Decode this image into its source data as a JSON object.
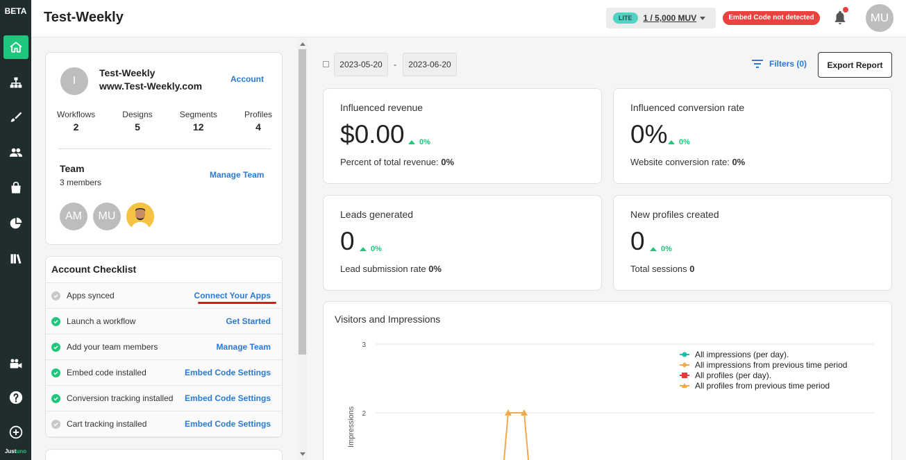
{
  "sidebar": {
    "badge": "BETA",
    "brand_main": "Just",
    "brand_accent": "uno",
    "items": [
      {
        "name": "home-icon"
      },
      {
        "name": "workflows-icon"
      },
      {
        "name": "designs-brush-icon"
      },
      {
        "name": "segments-users-icon"
      },
      {
        "name": "shopping-bag-icon"
      },
      {
        "name": "reports-pie-icon"
      },
      {
        "name": "library-books-icon"
      }
    ],
    "bottom_items": [
      {
        "name": "video-camera-icon"
      },
      {
        "name": "help-icon"
      },
      {
        "name": "add-circle-icon"
      }
    ]
  },
  "header": {
    "title": "Test-Weekly",
    "plan": "LITE",
    "muv": "1 / 5,000 MUV",
    "embed_status": "Embed Code not detected",
    "avatar": "MU"
  },
  "account": {
    "avatar": "I",
    "name": "Test-Weekly",
    "site": "www.Test-Weekly.com",
    "link": "Account",
    "stats": [
      {
        "label": "Workflows",
        "value": "2"
      },
      {
        "label": "Designs",
        "value": "5"
      },
      {
        "label": "Segments",
        "value": "12"
      },
      {
        "label": "Profiles",
        "value": "4"
      }
    ],
    "team_title": "Team",
    "team_count": "3 members",
    "team_link": "Manage Team",
    "members": [
      "AM",
      "MU"
    ]
  },
  "checklist": {
    "title": "Account Checklist",
    "items": [
      {
        "label": "Apps synced",
        "action": "Connect Your Apps",
        "done": false
      },
      {
        "label": "Launch a workflow",
        "action": "Get Started",
        "done": true
      },
      {
        "label": "Add your team members",
        "action": "Manage Team",
        "done": true
      },
      {
        "label": "Embed code installed",
        "action": "Embed Code Settings",
        "done": true
      },
      {
        "label": "Conversion tracking installed",
        "action": "Embed Code Settings",
        "done": true
      },
      {
        "label": "Cart tracking installed",
        "action": "Embed Code Settings",
        "done": false
      }
    ]
  },
  "toolbar": {
    "date_start": "2023-05-20",
    "date_sep": "-",
    "date_end": "2023-06-20",
    "filters": "Filters (0)",
    "export": "Export Report"
  },
  "metrics": [
    {
      "title": "Influenced revenue",
      "value": "$0.00",
      "delta": "0%",
      "sub_label": "Percent of total revenue: ",
      "sub_value": "0%"
    },
    {
      "title": "Influenced conversion rate",
      "value": "0%",
      "delta": "0%",
      "sub_label": "Website conversion rate: ",
      "sub_value": "0%"
    },
    {
      "title": "Leads generated",
      "value": "0",
      "delta": "0%",
      "sub_label": "Lead submission rate ",
      "sub_value": "0%"
    },
    {
      "title": "New profiles created",
      "value": "0",
      "delta": "0%",
      "sub_label": "Total sessions ",
      "sub_value": "0"
    }
  ],
  "chart_data": {
    "type": "line",
    "title": "Visitors and Impressions",
    "ylabel": "Impressions",
    "ylim_visible": [
      2,
      3
    ],
    "y_ticks": [
      "3",
      "2"
    ],
    "legend_position": "top-right",
    "series": [
      {
        "name": "All impressions (per day).",
        "color": "#1bbfa8",
        "marker": "circle"
      },
      {
        "name": "All impressions from previous time period",
        "color": "#f2a94a",
        "marker": "diamond"
      },
      {
        "name": "All profiles (per day).",
        "color": "#e53935",
        "marker": "square"
      },
      {
        "name": "All profiles from previous time period",
        "color": "#f2a94a",
        "marker": "triangle",
        "visible_values": [
          0,
          2,
          2,
          0
        ]
      }
    ]
  },
  "colors": {
    "accent": "#1ec77b",
    "link": "#2a7ad3",
    "sidebar": "#1f2d2d",
    "danger": "#e8433f"
  }
}
